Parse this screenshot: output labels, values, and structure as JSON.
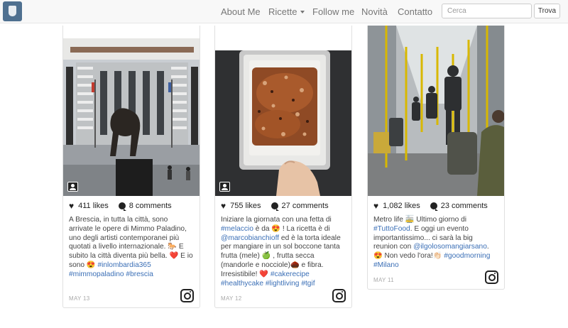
{
  "nav": {
    "logo_alt": "logo",
    "items": [
      {
        "label": "About Me"
      },
      {
        "label": "Ricette"
      },
      {
        "label": "Follow me"
      },
      {
        "label": "Novità"
      },
      {
        "label": "Contatto"
      }
    ],
    "search": {
      "placeholder": "Cerca",
      "button": "Trova"
    }
  },
  "cards": [
    {
      "likes": "411 likes",
      "comments": "8 comments",
      "caption_parts": [
        {
          "text": "A Brescia, in tutta la città, sono arrivate le opere di Mimmo Paladino, uno degli artisti contemporanei più quotati a livello internazionale. 🐎 E subito la città diventa più bella. ❤️ E io sono 😍 "
        },
        {
          "text": "#inlombardia365",
          "tag": true
        },
        {
          "text": " "
        },
        {
          "text": "#mimmopaladino",
          "tag": true
        },
        {
          "text": " "
        },
        {
          "text": "#brescia",
          "tag": true
        }
      ],
      "date": "MAY 13"
    },
    {
      "likes": "755 likes",
      "comments": "27 comments",
      "caption_parts": [
        {
          "text": "Iniziare la giornata con una fetta di "
        },
        {
          "text": "#melaccio",
          "tag": true
        },
        {
          "text": " è da 😍 ! La ricetta è di "
        },
        {
          "text": "@marcobianchioff",
          "tag": true
        },
        {
          "text": " ed è la torta ideale per mangiare in un sol boccone tanta frutta (mele) 🍏 , frutta secca (mandorle e nocciole)🌰  e fibra. Irresistibile! ❤️ "
        },
        {
          "text": "#cakerecipe",
          "tag": true
        },
        {
          "text": " "
        },
        {
          "text": "#healthycake",
          "tag": true
        },
        {
          "text": " "
        },
        {
          "text": "#lightliving",
          "tag": true
        },
        {
          "text": " "
        },
        {
          "text": "#tgif",
          "tag": true
        }
      ],
      "date": "MAY 12"
    },
    {
      "likes": "1,082 likes",
      "comments": "23 comments",
      "caption_parts": [
        {
          "text": "Metro life 🚋 Ultimo giorno di "
        },
        {
          "text": "#TuttoFood",
          "tag": true
        },
        {
          "text": ". E oggi un evento importantissimo... ci sarà la big reunion con "
        },
        {
          "text": "@ilgolosomangiarsano",
          "tag": true
        },
        {
          "text": ". 😍 Non vedo l'ora!👏🏻 "
        },
        {
          "text": "#goodmorning",
          "tag": true
        },
        {
          "text": " "
        },
        {
          "text": "#Milano",
          "tag": true
        }
      ],
      "date": "MAY 11"
    }
  ],
  "colors": {
    "tag": "#3b6fb6",
    "navbar": "#f8f8f8",
    "logo": "#4f7090"
  },
  "icons": [
    "heart-icon",
    "comment-icon",
    "instagram-icon",
    "photo-badge-icon",
    "caret-down-icon"
  ]
}
